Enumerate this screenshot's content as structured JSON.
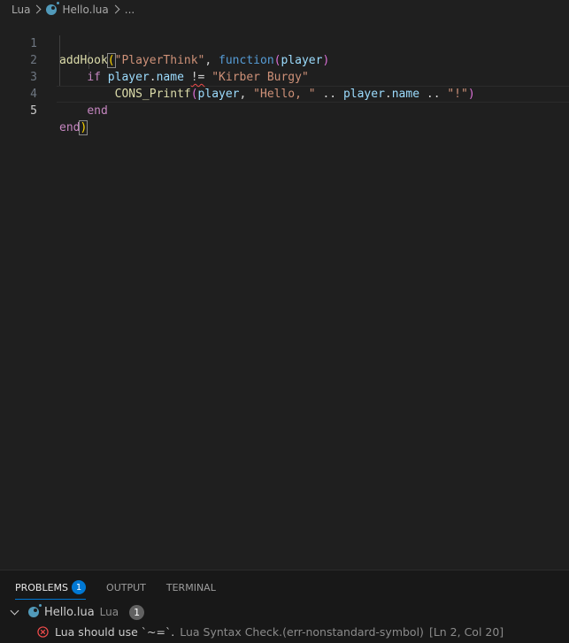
{
  "breadcrumb": {
    "items": [
      {
        "label": "Lua"
      },
      {
        "label": "Hello.lua"
      },
      {
        "label": "..."
      }
    ]
  },
  "editor": {
    "line_numbers": [
      "1",
      "2",
      "3",
      "4",
      "5"
    ],
    "lines": [
      {
        "tokens": [
          "addHook",
          "(",
          "\"PlayerThink\"",
          ", ",
          "function",
          "(",
          "player",
          ")"
        ]
      },
      {
        "tokens": [
          "    ",
          "if",
          " ",
          "player",
          ".",
          "name",
          " ",
          "!=",
          " ",
          "\"Kirber Burgy\""
        ]
      },
      {
        "tokens": [
          "        ",
          "CONS_Printf",
          "(",
          "player",
          ", ",
          "\"Hello, \"",
          " .. ",
          "player",
          ".",
          "name",
          " .. ",
          "\"!\"",
          ")"
        ]
      },
      {
        "tokens": [
          "    ",
          "end"
        ]
      },
      {
        "tokens": [
          "end",
          ")"
        ]
      }
    ]
  },
  "panel": {
    "tabs": [
      {
        "label": "PROBLEMS",
        "badge": "1"
      },
      {
        "label": "OUTPUT"
      },
      {
        "label": "TERMINAL"
      }
    ],
    "file": {
      "name": "Hello.lua",
      "lang": "Lua",
      "count": "1"
    },
    "problem": {
      "message": "Lua should use `~=`.",
      "source": "Lua Syntax Check.(err-nonstandard-symbol)",
      "position": "[Ln 2, Col 20]"
    }
  }
}
